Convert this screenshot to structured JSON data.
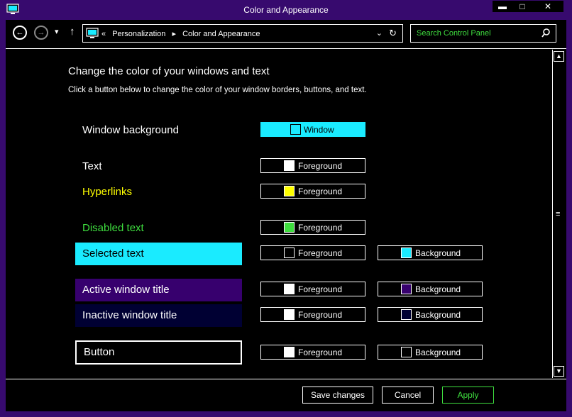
{
  "window": {
    "title": "Color and Appearance",
    "minimize_glyph": "▬",
    "maximize_glyph": "□",
    "close_glyph": "✕"
  },
  "navbar": {
    "back_glyph": "←",
    "forward_glyph": "→",
    "recent_glyph": "▾",
    "up_glyph": "↑",
    "breadcrumb": {
      "overflow": "«",
      "items": [
        "Personalization",
        "Color and Appearance"
      ],
      "separator": "▸"
    },
    "dropdown_glyph": "⌄",
    "refresh_glyph": "↻",
    "search_placeholder": "Search Control Panel"
  },
  "page": {
    "heading": "Change the color of your windows and text",
    "subheading": "Click a button below to change the color of your window borders, buttons, and text."
  },
  "colors": {
    "window_bg": "#000000",
    "accent_cyan": "#1aebff",
    "hyperlink": "#ffff00",
    "disabled": "#3fdf3f",
    "active_title": "#37006e",
    "inactive_title": "#000033",
    "title_frame": "#370a6e"
  },
  "rows": [
    {
      "label": "Window background",
      "fg_label": "Window",
      "fg_color": "#000000"
    },
    {
      "label": "Text",
      "fg_label": "Foreground",
      "fg_color": "#ffffff"
    },
    {
      "label": "Hyperlinks",
      "fg_label": "Foreground",
      "fg_color": "#ffff00"
    },
    {
      "label": "Disabled text",
      "fg_label": "Foreground",
      "fg_color": "#3fdf3f"
    },
    {
      "label": "Selected text",
      "fg_label": "Foreground",
      "fg_color": "#000000",
      "bg_label": "Background",
      "bg_color": "#1aebff"
    },
    {
      "label": "Active window title",
      "fg_label": "Foreground",
      "fg_color": "#ffffff",
      "bg_label": "Background",
      "bg_color": "#37006e"
    },
    {
      "label": "Inactive window title",
      "fg_label": "Foreground",
      "fg_color": "#ffffff",
      "bg_label": "Background",
      "bg_color": "#000033"
    },
    {
      "label": "Button",
      "fg_label": "Foreground",
      "fg_color": "#ffffff",
      "bg_label": "Background",
      "bg_color": "#000000"
    }
  ],
  "scrollbar": {
    "up_glyph": "▲",
    "down_glyph": "▼",
    "grip_glyph": "≡"
  },
  "footer": {
    "save": "Save changes",
    "cancel": "Cancel",
    "apply": "Apply"
  }
}
